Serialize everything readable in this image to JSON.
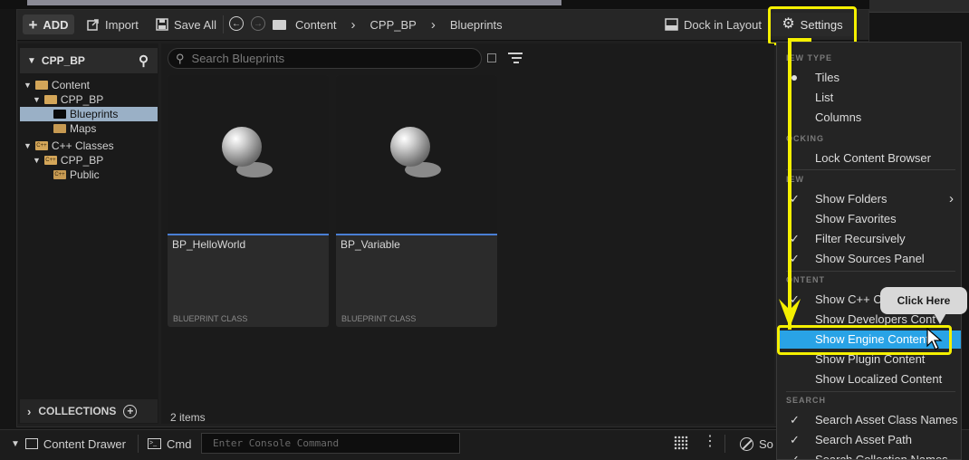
{
  "toolbar": {
    "add_label": "ADD",
    "import_label": "Import",
    "save_all_label": "Save All",
    "breadcrumb": [
      "Content",
      "CPP_BP",
      "Blueprints"
    ],
    "dock_label": "Dock in Layout",
    "settings_label": "Settings"
  },
  "sources": {
    "header": "CPP_BP",
    "tree": [
      {
        "label": "Content"
      },
      {
        "label": "CPP_BP"
      },
      {
        "label": "Blueprints"
      },
      {
        "label": "Maps"
      },
      {
        "label": "C++ Classes"
      },
      {
        "label": "CPP_BP"
      },
      {
        "label": "Public"
      }
    ],
    "collections_label": "COLLECTIONS"
  },
  "content": {
    "search_placeholder": "Search Blueprints",
    "assets": [
      {
        "name": "BP_HelloWorld",
        "type": "BLUEPRINT CLASS"
      },
      {
        "name": "BP_Variable",
        "type": "BLUEPRINT CLASS"
      }
    ],
    "item_count": "2 items"
  },
  "bottom_bar": {
    "content_drawer": "Content Drawer",
    "cmd": "Cmd",
    "console_placeholder": "Enter Console Command",
    "source_partial": "So"
  },
  "settings_menu": {
    "sections": {
      "view_type": "IEW TYPE",
      "docking": "OCKING",
      "view": "IEW",
      "content": "ONTENT",
      "search": "SEARCH"
    },
    "items": {
      "tiles": "Tiles",
      "list": "List",
      "columns": "Columns",
      "lock": "Lock Content Browser",
      "show_folders": "Show Folders",
      "show_favorites": "Show Favorites",
      "filter_recursively": "Filter Recursively",
      "show_sources": "Show Sources Panel",
      "show_cpp": "Show C++ Cl",
      "show_developers": "Show Developers Cont",
      "show_engine": "Show Engine Content",
      "show_plugin": "Show Plugin Content",
      "show_localized": "Show Localized Content",
      "search_class_names": "Search Asset Class Names",
      "search_asset_path": "Search Asset Path",
      "search_collection_names": "Search Collection Names"
    }
  },
  "annotation": {
    "tooltip": "Click Here",
    "highlight_color": "#f5f000"
  }
}
